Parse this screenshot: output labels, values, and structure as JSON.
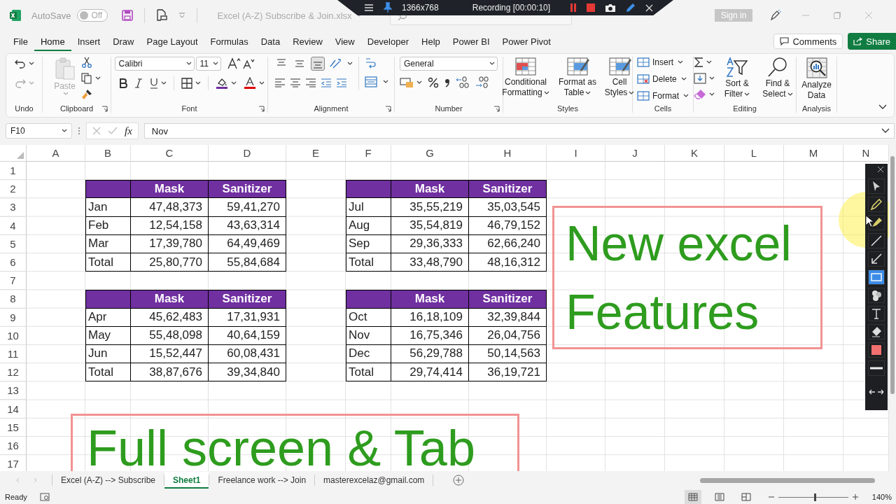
{
  "title_bar": {
    "autosave": {
      "label": "AutoSave",
      "state": "Off",
      "on": false
    },
    "filename": "Excel (A-Z) Subscribe & Join.xlsx",
    "sign_in": "Sign in"
  },
  "recorder": {
    "resolution": "1366x768",
    "status": "Recording [00:00:10]"
  },
  "menu_tabs": [
    {
      "label": "File",
      "selected": false
    },
    {
      "label": "Home",
      "selected": true
    },
    {
      "label": "Insert",
      "selected": false
    },
    {
      "label": "Draw",
      "selected": false
    },
    {
      "label": "Page Layout",
      "selected": false
    },
    {
      "label": "Formulas",
      "selected": false
    },
    {
      "label": "Data",
      "selected": false
    },
    {
      "label": "Review",
      "selected": false
    },
    {
      "label": "View",
      "selected": false
    },
    {
      "label": "Developer",
      "selected": false
    },
    {
      "label": "Help",
      "selected": false
    },
    {
      "label": "Power BI",
      "selected": false
    },
    {
      "label": "Power Pivot",
      "selected": false
    }
  ],
  "comments": "Comments",
  "share": "Share",
  "ribbon": {
    "undo": {
      "label": "Undo",
      "redo_disabled": true
    },
    "clipboard": {
      "label": "Clipboard",
      "paste": "Paste",
      "paste_disabled": true
    },
    "font": {
      "label": "Font",
      "family": "Calibri",
      "size": "11"
    },
    "alignment": {
      "label": "Alignment",
      "vertical_buttons": [
        {
          "kind": "top",
          "selected": false
        },
        {
          "kind": "middle",
          "selected": false
        },
        {
          "kind": "bottom",
          "selected": true
        }
      ]
    },
    "number": {
      "label": "Number",
      "format": "General"
    },
    "styles": {
      "label": "Styles",
      "buttons": [
        "Conditional Formatting",
        "Format as Table",
        "Cell Styles"
      ]
    },
    "cells": {
      "label": "Cells",
      "buttons": [
        "Insert",
        "Delete",
        "Format"
      ]
    },
    "editing": {
      "label": "Editing",
      "buttons": [
        "Sort & Filter",
        "Find & Select"
      ]
    },
    "analysis": {
      "label": "Analysis",
      "button": "Analyze Data"
    }
  },
  "formula_bar": {
    "name_box": "F10",
    "fx": "fx",
    "value": "Nov"
  },
  "sheet": {
    "columns": [
      "A",
      "B",
      "C",
      "D",
      "E",
      "F",
      "G",
      "H",
      "I",
      "J",
      "K",
      "L",
      "M",
      "N"
    ],
    "rows": [
      "1",
      "2",
      "3",
      "4",
      "5",
      "6",
      "7",
      "8",
      "9",
      "10",
      "11",
      "12",
      "13",
      "14",
      "15",
      "16",
      "17"
    ],
    "tables": [
      {
        "header": [
          "Mask",
          "Sanitizer"
        ],
        "rows": [
          [
            "Jan",
            "47,48,373",
            "59,41,270"
          ],
          [
            "Feb",
            "12,54,158",
            "43,63,314"
          ],
          [
            "Mar",
            "17,39,780",
            "64,49,469"
          ],
          [
            "Total",
            "25,80,770",
            "55,84,684"
          ]
        ]
      },
      {
        "header": [
          "Mask",
          "Sanitizer"
        ],
        "rows": [
          [
            "Jul",
            "35,55,219",
            "35,03,545"
          ],
          [
            "Aug",
            "35,54,819",
            "46,79,152"
          ],
          [
            "Sep",
            "29,36,333",
            "62,66,240"
          ],
          [
            "Total",
            "33,48,790",
            "48,16,312"
          ]
        ]
      },
      {
        "header": [
          "Mask",
          "Sanitizer"
        ],
        "rows": [
          [
            "Apr",
            "45,62,483",
            "17,31,931"
          ],
          [
            "May",
            "55,48,098",
            "40,64,159"
          ],
          [
            "Jun",
            "15,52,447",
            "60,08,431"
          ],
          [
            "Total",
            "38,87,676",
            "39,34,840"
          ]
        ]
      },
      {
        "header": [
          "Mask",
          "Sanitizer"
        ],
        "rows": [
          [
            "Oct",
            "16,18,109",
            "32,39,844"
          ],
          [
            "Nov",
            "16,75,346",
            "26,04,756"
          ],
          [
            "Dec",
            "56,29,788",
            "50,14,563"
          ],
          [
            "Total",
            "29,74,414",
            "36,19,721"
          ]
        ]
      }
    ]
  },
  "annotations": [
    {
      "kind": "box",
      "lines": [
        "New excel",
        "Features"
      ]
    },
    {
      "kind": "box",
      "lines": [
        "Full screen & Tab"
      ]
    }
  ],
  "drawing_toolbar": {
    "tools": [
      {
        "kind": "pointer",
        "selected": false
      },
      {
        "kind": "pen",
        "selected": false
      },
      {
        "kind": "highlighter",
        "selected": false
      },
      {
        "kind": "line",
        "selected": false
      },
      {
        "kind": "arrow",
        "selected": false
      },
      {
        "kind": "rectangle",
        "selected": true
      },
      {
        "kind": "numbering",
        "selected": false
      },
      {
        "kind": "text",
        "selected": false
      },
      {
        "kind": "eraser",
        "selected": false
      },
      {
        "kind": "swatch",
        "selected": false,
        "color": "#f07070"
      },
      {
        "kind": "width",
        "selected": false
      }
    ]
  },
  "sheet_tabs": [
    {
      "label": "Excel (A-Z) --> Subscribe",
      "selected": false
    },
    {
      "label": "Sheet1",
      "selected": true
    },
    {
      "label": "Freelance work --> Join",
      "selected": false
    },
    {
      "label": "masterexcelaz@gmail.com",
      "selected": false
    }
  ],
  "status_bar": {
    "text": "Ready",
    "views": [
      {
        "kind": "normal",
        "selected": true
      },
      {
        "kind": "layout",
        "selected": false
      },
      {
        "kind": "break",
        "selected": false
      }
    ],
    "zoom": {
      "level": 0.52,
      "reading": "140%"
    }
  }
}
